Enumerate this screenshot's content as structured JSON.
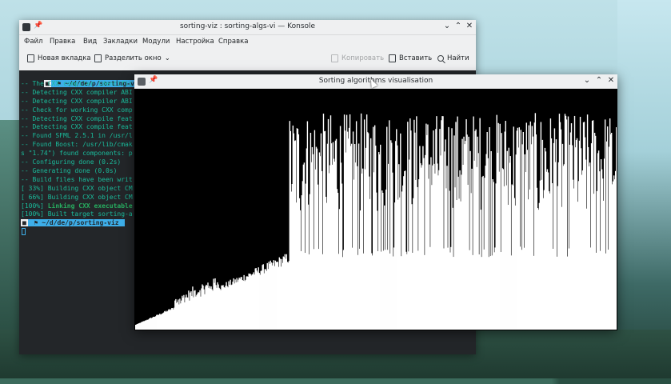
{
  "konsole": {
    "title": "sorting-viz : sorting-algs-vi — Konsole",
    "menu": [
      "Файл",
      "Правка",
      "Вид",
      "Закладки",
      "Модули",
      "Настройка",
      "Справка"
    ],
    "toolbar": {
      "new_tab": "Новая вкладка",
      "split_view": "Разделить окно",
      "copy": "Копировать",
      "paste": "Вставить",
      "find": "Найти"
    },
    "terminal": {
      "prompt_dir": "~/d/de/p/sorting-viz",
      "lines": [
        "-- The CXX compiler identific",
        "-- Detecting CXX compiler ABI",
        "-- Detecting CXX compiler ABI",
        "-- Check for working CXX comp",
        "-- Detecting CXX compile feat",
        "-- Detecting CXX compile feat",
        "-- Found SFML 2.5.1 in /usr/l",
        "-- Found Boost: /usr/lib/cmak",
        "s \"1.74\") found components: p",
        "-- Configuring done (0.2s)",
        "-- Generating done (0.0s)",
        "-- Build files have been writ",
        "[ 33%] Building CXX object CM",
        "[ 66%] Building CXX object CM",
        "[100%] Linking CXX executable",
        "[100%] Built target sorting-a"
      ],
      "linking_prefix": "[100%] ",
      "linking_text": "Linking CXX executable"
    }
  },
  "sortwin": {
    "title": "Sorting algorithms visualisation"
  },
  "chart_data": {
    "type": "bar",
    "description_values": "sorted prefix rising from 0 to ~0.32, then unsorted random bars 0.3–0.9 of height",
    "bar_count": 600,
    "sorted_fraction": 0.32,
    "bar_color": "#ffffff",
    "background": "#000000"
  },
  "colors": {
    "accent": "#3daee9",
    "terminal_text": "#1abc9c",
    "titlebar": "#eff0f1",
    "terminal_bg": "#232629"
  }
}
